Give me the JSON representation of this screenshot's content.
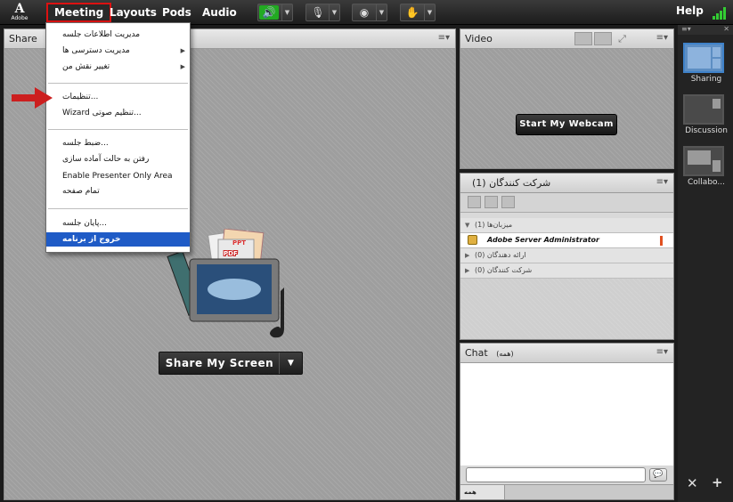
{
  "app": {
    "logo_text": "Adobe",
    "menubar": {
      "items": [
        "Meeting",
        "Layouts",
        "Pods",
        "Audio"
      ],
      "help": "Help"
    }
  },
  "meeting_menu": {
    "groups": [
      [
        {
          "label": "مدیریت اطلاعات جلسه",
          "submenu": false
        },
        {
          "label": "مدیریت دسترسی ها",
          "submenu": true
        },
        {
          "label": "تغییر نقش من",
          "submenu": true
        }
      ],
      [
        {
          "label": "تنظیمات...",
          "submenu": false
        },
        {
          "label": "Wizard تنظیم صوتی...",
          "submenu": false
        }
      ],
      [
        {
          "label": "ضبط جلسه...",
          "submenu": false
        },
        {
          "label": "رفتن به حالت آماده سازی",
          "submenu": false
        },
        {
          "label": "Enable Presenter Only Area",
          "submenu": false
        },
        {
          "label": "تمام صفحه",
          "submenu": false
        }
      ],
      [
        {
          "label": "پایان جلسه...",
          "submenu": false
        },
        {
          "label": "خروج از برنامه",
          "submenu": false,
          "highlighted": true
        }
      ]
    ]
  },
  "share_pod": {
    "title": "Share",
    "share_button": "Share My Screen",
    "doc_labels": [
      "PPT",
      "PDF"
    ]
  },
  "video_pod": {
    "title": "Video",
    "webcam_button": "Start My Webcam"
  },
  "attendees_pod": {
    "title": "شرکت کنندگان",
    "count": "(1)",
    "rows": [
      {
        "kind": "group",
        "label": "میزبان‌ها (1)",
        "expanded": true
      },
      {
        "kind": "user",
        "label": "Adobe Server Administrator"
      },
      {
        "kind": "group",
        "label": "ارائه دهندگان (0)",
        "expanded": false
      },
      {
        "kind": "group",
        "label": "شرکت کنندگان (0)",
        "expanded": false
      }
    ]
  },
  "chat_pod": {
    "title": "Chat",
    "scope": "(همه)",
    "tab": "همه",
    "input_placeholder": ""
  },
  "layouts_rail": {
    "items": [
      "Sharing",
      "Discussion",
      "Collabo..."
    ],
    "selected": "Sharing"
  },
  "colors": {
    "menu_highlight": "#1f5bc6",
    "active_menu_border": "#dd1111",
    "audio_on": "#33cc33",
    "annotation_arrow": "#cc1f1f",
    "rail_selected": "#3f82c9"
  }
}
